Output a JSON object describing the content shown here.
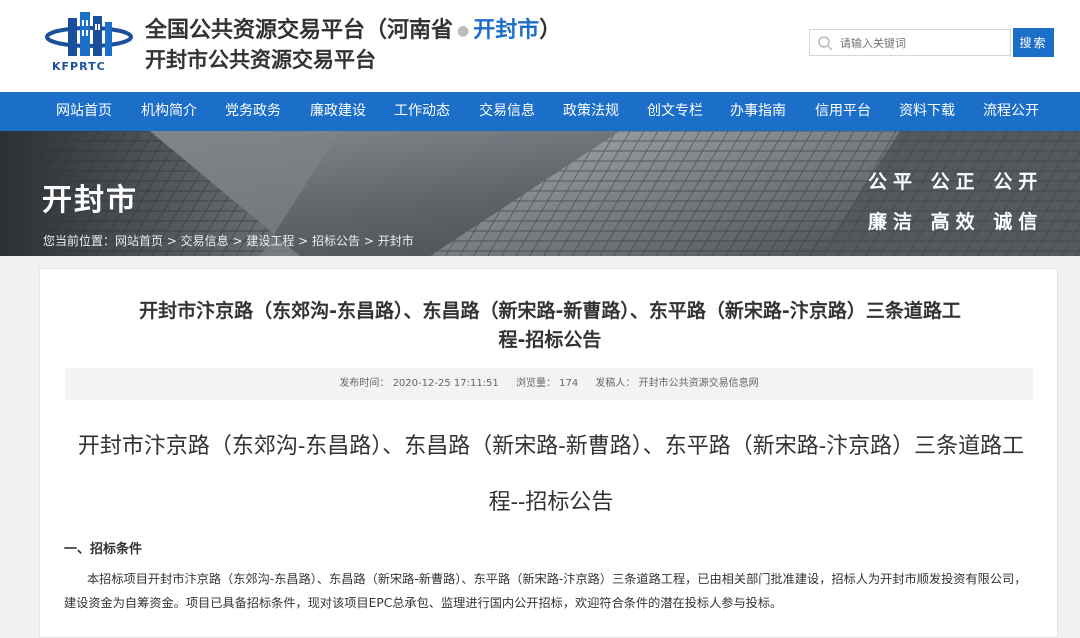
{
  "header": {
    "logo_caption": "KFPRTC",
    "title_prefix": "全国公共资源交易平台（河南省",
    "title_dot": "●",
    "title_city": "开封市",
    "title_suffix": "）",
    "subtitle": "开封市公共资源交易平台"
  },
  "search": {
    "placeholder": "请输入关键词",
    "button_label": "搜索"
  },
  "nav": {
    "items": [
      "网站首页",
      "机构简介",
      "党务政务",
      "廉政建设",
      "工作动态",
      "交易信息",
      "政策法规",
      "创文专栏",
      "办事指南",
      "信用平台",
      "资料下载",
      "流程公开"
    ]
  },
  "banner": {
    "city": "开封市",
    "breadcrumb": "您当前位置：网站首页 > 交易信息 > 建设工程 > 招标公告 > 开封市",
    "slogan_line1": "公平 公正 公开",
    "slogan_line2": "廉洁 高效 诚信"
  },
  "article": {
    "title_line1": "开封市汴京路（东郊沟-东昌路）、东昌路（新宋路-新曹路）、东平路（新宋路-汴京路）三条道路工",
    "title_line2": "程-招标公告",
    "meta_publish": "发布时间： 2020-12-25 17:11:51",
    "meta_views": "浏览量： 174",
    "meta_publisher": "发稿人： 开封市公共资源交易信息网",
    "big_title": "开封市汴京路（东郊沟-东昌路）、东昌路（新宋路-新曹路）、东平路（新宋路-汴京路）三条道路工程--招标公告",
    "section1_heading": "一、招标条件",
    "section1_text": "本招标项目开封市汴京路（东郊沟-东昌路）、东昌路（新宋路-新曹路）、东平路（新宋路-汴京路）三条道路工程，已由相关部门批准建设，招标人为开封市顺发投资有限公司，建设资金为自筹资金。项目已具备招标条件，现对该项目EPC总承包、监理进行国内公开招标，欢迎符合条件的潜在投标人参与投标。"
  },
  "colors": {
    "brand_blue": "#1c6fc9",
    "page_bg": "#f1f1f1",
    "meta_bg": "#f3f3f3"
  }
}
